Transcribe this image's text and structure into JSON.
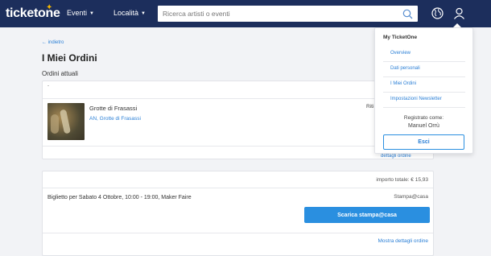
{
  "header": {
    "logo": "ticketone",
    "nav": [
      {
        "label": "Eventi"
      },
      {
        "label": "Località"
      }
    ],
    "search_placeholder": "Ricerca artisti o eventi"
  },
  "page": {
    "back_label": "indietro",
    "title": "I Miei Ordini",
    "section_title": "Ordini attuali"
  },
  "order1": {
    "header_text": "-",
    "event_name": "Grotte di Frasassi",
    "event_location": "AN, Grotte di Frasassi",
    "delivery": "Riti",
    "details_partial": "dettagli ordine"
  },
  "order2": {
    "total": "importo totale: € 15,93",
    "ticket": "Biglietto per Sabato 4 Ottobre, 10:00 - 19:00, Maker Faire",
    "delivery": "Stampa@casa",
    "print_button": "Scarica stampa@casa",
    "details_link": "Mostra dettagli ordine"
  },
  "account_menu": {
    "title": "My TicketOne",
    "items": [
      {
        "label": "Overview"
      },
      {
        "label": "Dati personali"
      },
      {
        "label": "I Miei Ordini"
      },
      {
        "label": "Impostazioni Newsletter"
      }
    ],
    "registered_as_label": "Registrato come:",
    "user_name": "Manuel Orrù",
    "logout_button": "Esci"
  },
  "colors": {
    "header_bg": "#1c2e5c",
    "accent": "#2a8fe0",
    "logo_star": "#f6b800"
  }
}
